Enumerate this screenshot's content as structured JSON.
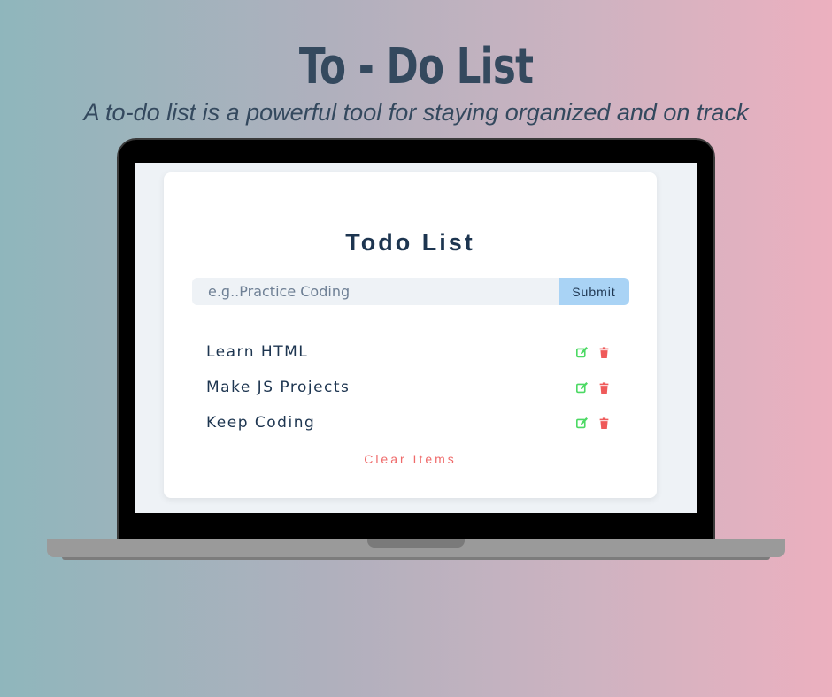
{
  "hero": {
    "title": "To - Do List",
    "subtitle": "A to-do list is a powerful tool for staying organized and on track"
  },
  "app": {
    "title": "Todo List",
    "input": {
      "placeholder": "e.g..Practice Coding",
      "value": ""
    },
    "submit_label": "Submit",
    "items": [
      {
        "text": "Learn HTML",
        "edit_icon": "edit-icon",
        "delete_icon": "trash-icon"
      },
      {
        "text": "Make JS Projects",
        "edit_icon": "edit-icon",
        "delete_icon": "trash-icon"
      },
      {
        "text": "Keep Coding",
        "edit_icon": "edit-icon",
        "delete_icon": "trash-icon"
      }
    ],
    "clear_label": "Clear Items"
  },
  "colors": {
    "edit": "#4cd964",
    "delete": "#ef5a5a",
    "submit_bg": "#a9d3f5",
    "clear_text": "#ef6a6a",
    "heading": "#1d3550"
  }
}
